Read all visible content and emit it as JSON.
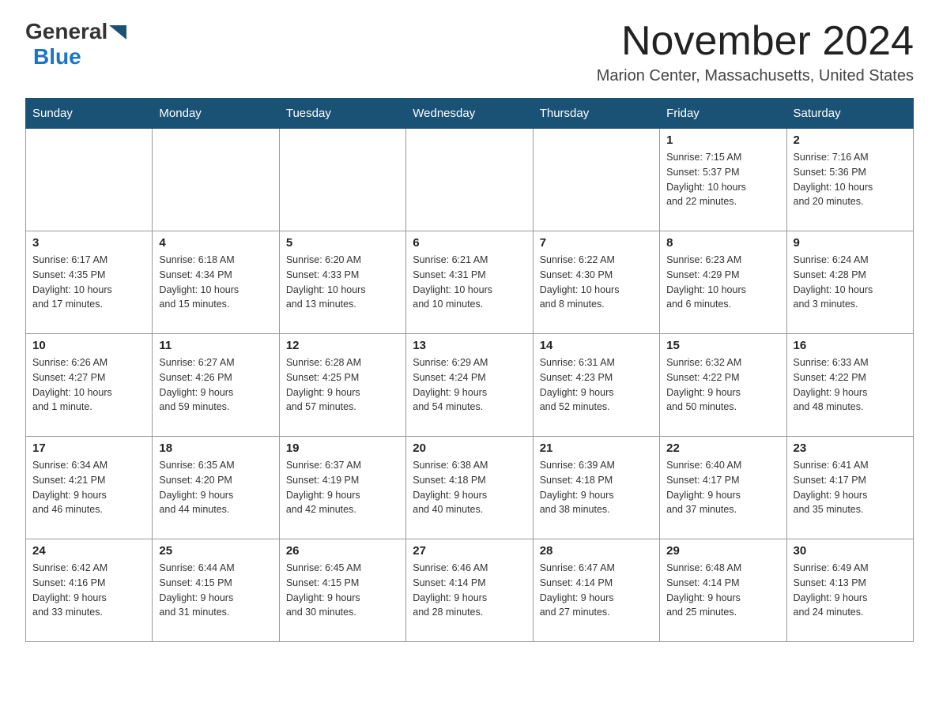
{
  "header": {
    "logo_general": "General",
    "logo_blue": "Blue",
    "title": "November 2024",
    "subtitle": "Marion Center, Massachusetts, United States"
  },
  "days_of_week": [
    "Sunday",
    "Monday",
    "Tuesday",
    "Wednesday",
    "Thursday",
    "Friday",
    "Saturday"
  ],
  "weeks": [
    [
      {
        "num": "",
        "info": ""
      },
      {
        "num": "",
        "info": ""
      },
      {
        "num": "",
        "info": ""
      },
      {
        "num": "",
        "info": ""
      },
      {
        "num": "",
        "info": ""
      },
      {
        "num": "1",
        "info": "Sunrise: 7:15 AM\nSunset: 5:37 PM\nDaylight: 10 hours\nand 22 minutes."
      },
      {
        "num": "2",
        "info": "Sunrise: 7:16 AM\nSunset: 5:36 PM\nDaylight: 10 hours\nand 20 minutes."
      }
    ],
    [
      {
        "num": "3",
        "info": "Sunrise: 6:17 AM\nSunset: 4:35 PM\nDaylight: 10 hours\nand 17 minutes."
      },
      {
        "num": "4",
        "info": "Sunrise: 6:18 AM\nSunset: 4:34 PM\nDaylight: 10 hours\nand 15 minutes."
      },
      {
        "num": "5",
        "info": "Sunrise: 6:20 AM\nSunset: 4:33 PM\nDaylight: 10 hours\nand 13 minutes."
      },
      {
        "num": "6",
        "info": "Sunrise: 6:21 AM\nSunset: 4:31 PM\nDaylight: 10 hours\nand 10 minutes."
      },
      {
        "num": "7",
        "info": "Sunrise: 6:22 AM\nSunset: 4:30 PM\nDaylight: 10 hours\nand 8 minutes."
      },
      {
        "num": "8",
        "info": "Sunrise: 6:23 AM\nSunset: 4:29 PM\nDaylight: 10 hours\nand 6 minutes."
      },
      {
        "num": "9",
        "info": "Sunrise: 6:24 AM\nSunset: 4:28 PM\nDaylight: 10 hours\nand 3 minutes."
      }
    ],
    [
      {
        "num": "10",
        "info": "Sunrise: 6:26 AM\nSunset: 4:27 PM\nDaylight: 10 hours\nand 1 minute."
      },
      {
        "num": "11",
        "info": "Sunrise: 6:27 AM\nSunset: 4:26 PM\nDaylight: 9 hours\nand 59 minutes."
      },
      {
        "num": "12",
        "info": "Sunrise: 6:28 AM\nSunset: 4:25 PM\nDaylight: 9 hours\nand 57 minutes."
      },
      {
        "num": "13",
        "info": "Sunrise: 6:29 AM\nSunset: 4:24 PM\nDaylight: 9 hours\nand 54 minutes."
      },
      {
        "num": "14",
        "info": "Sunrise: 6:31 AM\nSunset: 4:23 PM\nDaylight: 9 hours\nand 52 minutes."
      },
      {
        "num": "15",
        "info": "Sunrise: 6:32 AM\nSunset: 4:22 PM\nDaylight: 9 hours\nand 50 minutes."
      },
      {
        "num": "16",
        "info": "Sunrise: 6:33 AM\nSunset: 4:22 PM\nDaylight: 9 hours\nand 48 minutes."
      }
    ],
    [
      {
        "num": "17",
        "info": "Sunrise: 6:34 AM\nSunset: 4:21 PM\nDaylight: 9 hours\nand 46 minutes."
      },
      {
        "num": "18",
        "info": "Sunrise: 6:35 AM\nSunset: 4:20 PM\nDaylight: 9 hours\nand 44 minutes."
      },
      {
        "num": "19",
        "info": "Sunrise: 6:37 AM\nSunset: 4:19 PM\nDaylight: 9 hours\nand 42 minutes."
      },
      {
        "num": "20",
        "info": "Sunrise: 6:38 AM\nSunset: 4:18 PM\nDaylight: 9 hours\nand 40 minutes."
      },
      {
        "num": "21",
        "info": "Sunrise: 6:39 AM\nSunset: 4:18 PM\nDaylight: 9 hours\nand 38 minutes."
      },
      {
        "num": "22",
        "info": "Sunrise: 6:40 AM\nSunset: 4:17 PM\nDaylight: 9 hours\nand 37 minutes."
      },
      {
        "num": "23",
        "info": "Sunrise: 6:41 AM\nSunset: 4:17 PM\nDaylight: 9 hours\nand 35 minutes."
      }
    ],
    [
      {
        "num": "24",
        "info": "Sunrise: 6:42 AM\nSunset: 4:16 PM\nDaylight: 9 hours\nand 33 minutes."
      },
      {
        "num": "25",
        "info": "Sunrise: 6:44 AM\nSunset: 4:15 PM\nDaylight: 9 hours\nand 31 minutes."
      },
      {
        "num": "26",
        "info": "Sunrise: 6:45 AM\nSunset: 4:15 PM\nDaylight: 9 hours\nand 30 minutes."
      },
      {
        "num": "27",
        "info": "Sunrise: 6:46 AM\nSunset: 4:14 PM\nDaylight: 9 hours\nand 28 minutes."
      },
      {
        "num": "28",
        "info": "Sunrise: 6:47 AM\nSunset: 4:14 PM\nDaylight: 9 hours\nand 27 minutes."
      },
      {
        "num": "29",
        "info": "Sunrise: 6:48 AM\nSunset: 4:14 PM\nDaylight: 9 hours\nand 25 minutes."
      },
      {
        "num": "30",
        "info": "Sunrise: 6:49 AM\nSunset: 4:13 PM\nDaylight: 9 hours\nand 24 minutes."
      }
    ]
  ]
}
